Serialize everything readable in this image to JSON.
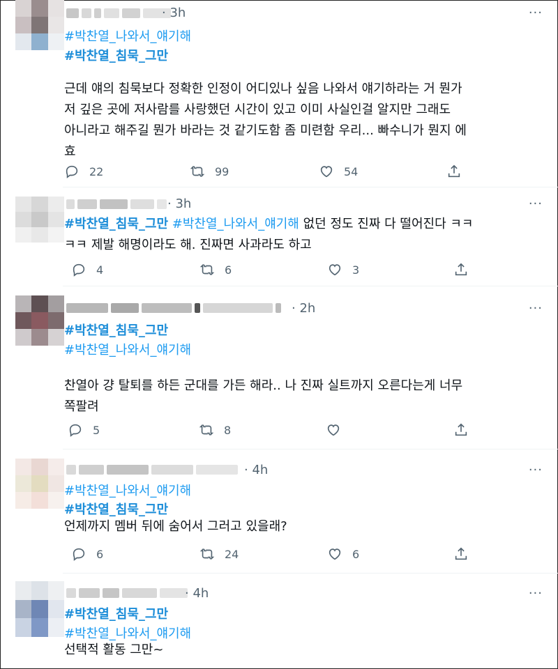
{
  "tweets": [
    {
      "time": "· 3h",
      "hashtags": [
        "#박찬열_나와서_얘기해",
        "#박찬열_침묵_그만"
      ],
      "text_lines": [
        "근데 얘의 침묵보다 정확한 인정이 어디있나 싶음 나와서 얘기하라는 거 뭔가",
        "저 깊은 곳에 저사람를 사랑했던 시간이 있고 이미 사실인걸 알지만 그래도",
        "아니라고 해주길 뭔가 바라는 것 같기도함 좀 미련함 우리... 빠수니가 뭔지 에",
        "효"
      ],
      "replies": "22",
      "retweets": "99",
      "likes": "54"
    },
    {
      "time": "· 3h",
      "hashtags_inline": [
        "#박찬열_침묵_그만",
        "#박찬열_나와서_얘기해"
      ],
      "text_inline": " 없던 정도 진짜 다 떨어진다 ㅋㅋ",
      "text_lines": [
        "ㅋㅋ 제발 해명이라도 해. 진짜면 사과라도 하고"
      ],
      "replies": "4",
      "retweets": "6",
      "likes": "3"
    },
    {
      "time": "· 2h",
      "hashtags": [
        "#박찬열_침묵_그만",
        "#박찬열_나와서_얘기해"
      ],
      "text_lines": [
        "찬열아 걍 탈퇴를 하든 군대를 가든 해라.. 나 진짜 실트까지 오른다는게 너무",
        "쪽팔려"
      ],
      "replies": "5",
      "retweets": "8",
      "likes": ""
    },
    {
      "time": "· 4h",
      "hashtags": [
        "#박찬열_나와서_얘기해",
        "#박찬열_침묵_그만"
      ],
      "text_lines": [
        "언제까지 멤버 뒤에 숨어서 그러고 있을래?"
      ],
      "replies": "6",
      "retweets": "24",
      "likes": "6"
    },
    {
      "time": "· 4h",
      "hashtags": [
        "#박찬열_침묵_그만",
        "#박찬열_나와서_얘기해"
      ],
      "text_lines": [
        "선택적 활동 그만~"
      ]
    }
  ],
  "more_icon": "···",
  "icons": [
    "reply-icon",
    "retweet-icon",
    "like-icon",
    "share-icon",
    "more-icon"
  ],
  "colors": {
    "hashtag": "#1d9bf0",
    "meta": "#536471"
  }
}
